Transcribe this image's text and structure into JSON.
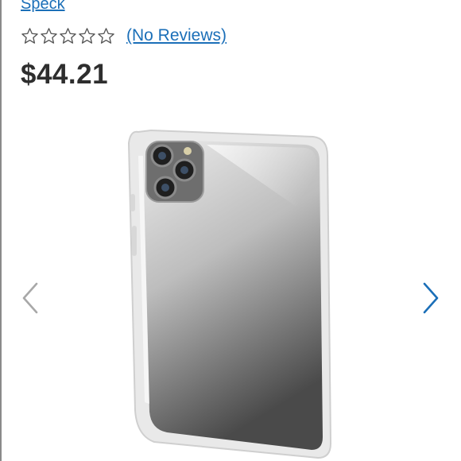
{
  "product": {
    "brand": "Speck",
    "rating_stars": 0,
    "rating_max": 5,
    "reviews_label": "(No Reviews)",
    "price": "$44.21"
  },
  "gallery": {
    "prev_icon": "chevron-left-icon",
    "next_icon": "chevron-right-icon"
  },
  "colors": {
    "link": "#1b6fb8",
    "price": "#2e2e2e",
    "star_outline": "#555555",
    "prev_arrow": "#a8a8a8",
    "next_arrow": "#1b6fb8"
  }
}
